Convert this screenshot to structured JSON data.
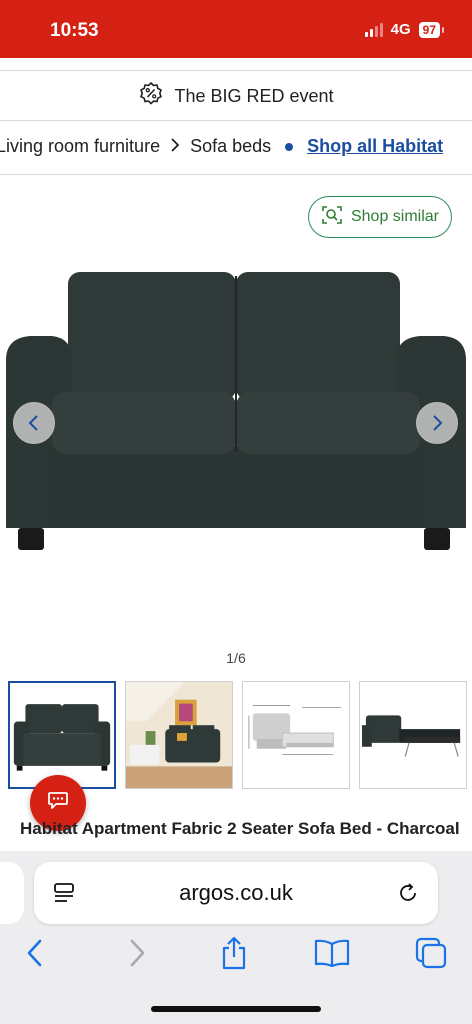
{
  "status_bar": {
    "time": "10:53",
    "network": "4G",
    "battery": "97"
  },
  "promo": {
    "text": "The BIG RED event",
    "icon": "percent-badge-icon"
  },
  "breadcrumb": {
    "category": "Living room furniture",
    "subcategory": "Sofa beds",
    "brand_link": "Shop all Habitat"
  },
  "shop_similar": {
    "label": "Shop similar",
    "icon": "visual-search-icon"
  },
  "gallery": {
    "counter": "1/6",
    "thumbnail_count": 4,
    "active_index": 0
  },
  "product": {
    "title": "Habitat Apartment Fabric 2 Seater Sofa Bed - Charcoal"
  },
  "browser": {
    "url": "argos.co.uk"
  },
  "colors": {
    "brand_red": "#d42114",
    "link_blue": "#1c4ea0",
    "accent_green": "#2e7d32",
    "ios_blue": "#1a73e8",
    "sofa_charcoal": "#2f3a38"
  }
}
